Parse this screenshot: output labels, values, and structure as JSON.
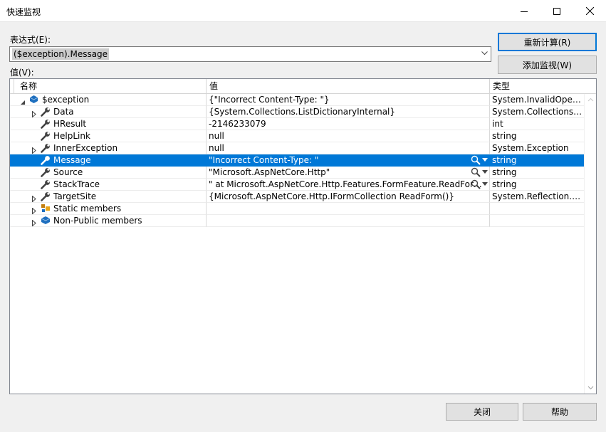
{
  "window": {
    "title": "快速监视"
  },
  "expression": {
    "label": "表达式(E):",
    "value": "($exception).Message"
  },
  "buttons": {
    "reevaluate": "重新计算(R)",
    "add_watch": "添加监视(W)",
    "close": "关闭",
    "help": "帮助"
  },
  "value_label": "值(V):",
  "grid": {
    "columns": [
      "名称",
      "值",
      "类型"
    ],
    "rows": [
      {
        "name": "$exception",
        "value": "{\"Incorrect Content-Type: \"}",
        "type": "System.InvalidOperati...",
        "level": 0,
        "expander": "expanded",
        "icon": "exception-icon",
        "selected": false,
        "tools": false
      },
      {
        "name": "Data",
        "value": "{System.Collections.ListDictionaryInternal}",
        "type": "System.Collections.IDic...",
        "level": 1,
        "expander": "collapsed",
        "icon": "wrench-icon",
        "selected": false,
        "tools": false
      },
      {
        "name": "HResult",
        "value": "-2146233079",
        "type": "int",
        "level": 1,
        "expander": "none",
        "icon": "wrench-icon",
        "selected": false,
        "tools": false
      },
      {
        "name": "HelpLink",
        "value": "null",
        "type": "string",
        "level": 1,
        "expander": "none",
        "icon": "wrench-icon",
        "selected": false,
        "tools": false
      },
      {
        "name": "InnerException",
        "value": "null",
        "type": "System.Exception",
        "level": 1,
        "expander": "collapsed",
        "icon": "wrench-icon",
        "selected": false,
        "tools": false
      },
      {
        "name": "Message",
        "value": "\"Incorrect Content-Type: \"",
        "type": "string",
        "level": 1,
        "expander": "none",
        "icon": "wrench-icon",
        "selected": true,
        "tools": true
      },
      {
        "name": "Source",
        "value": "\"Microsoft.AspNetCore.Http\"",
        "type": "string",
        "level": 1,
        "expander": "none",
        "icon": "wrench-icon",
        "selected": false,
        "tools": true
      },
      {
        "name": "StackTrace",
        "value": "\"   at Microsoft.AspNetCore.Http.Features.FormFeature.ReadForm()\\...",
        "type": "string",
        "level": 1,
        "expander": "none",
        "icon": "wrench-icon",
        "selected": false,
        "tools": true
      },
      {
        "name": "TargetSite",
        "value": "{Microsoft.AspNetCore.Http.IFormCollection ReadForm()}",
        "type": "System.Reflection.Met...",
        "level": 1,
        "expander": "collapsed",
        "icon": "wrench-icon",
        "selected": false,
        "tools": false
      },
      {
        "name": "Static members",
        "value": "",
        "type": "",
        "level": 1,
        "expander": "collapsed",
        "icon": "static-members-icon",
        "selected": false,
        "tools": false
      },
      {
        "name": "Non-Public members",
        "value": "",
        "type": "",
        "level": 1,
        "expander": "collapsed",
        "icon": "non-public-members-icon",
        "selected": false,
        "tools": false
      }
    ]
  },
  "colors": {
    "selection": "#0078d7",
    "object_icon": "#1e6fbf",
    "wrench": "#424242"
  }
}
